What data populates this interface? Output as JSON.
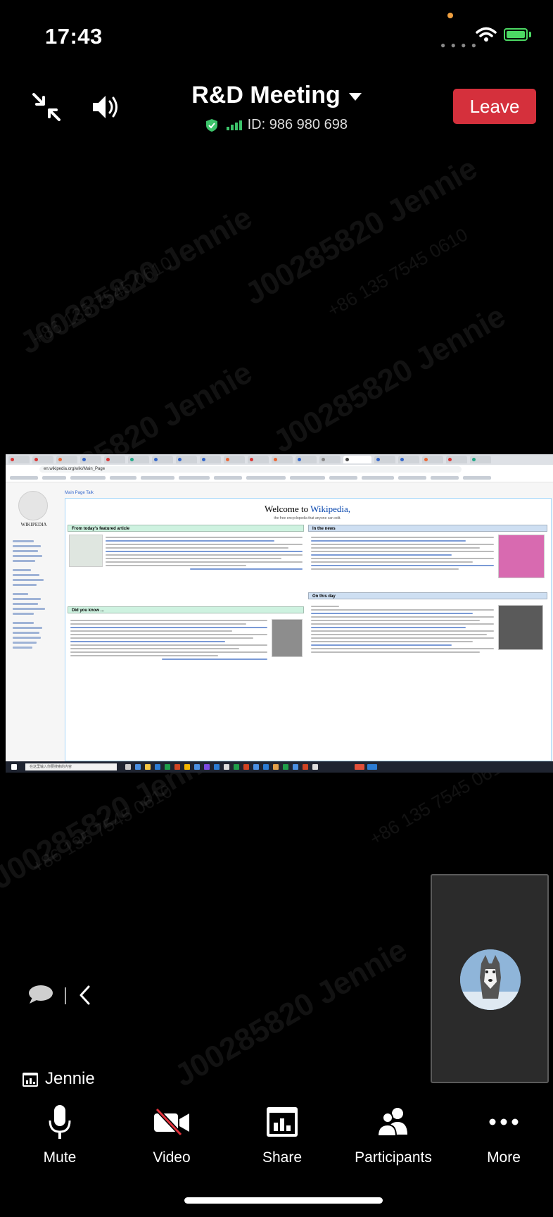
{
  "status_bar": {
    "time": "17:43",
    "battery_color": "#4cd964"
  },
  "header": {
    "meeting_title": "R&D Meeting",
    "meeting_id": "ID: 986 980 698",
    "leave_label": "Leave",
    "leave_color": "#d5303c"
  },
  "watermark": {
    "name_text": "J00285820 Jennie",
    "phone_text": "+86 135 7545 0610"
  },
  "shared_screen": {
    "url": "en.wikipedia.org/wiki/Main_Page",
    "tabs_row": "Main Page   Talk",
    "welcome_title": "Welcome to ",
    "welcome_link": "Wikipedia,",
    "welcome_sub": "the free encyclopedia that anyone can edit.",
    "logo_text": "WIKIPEDIA",
    "featured_heading": "From today's featured article",
    "news_heading": "In the news",
    "dyk_heading": "Did you know ...",
    "otd_heading": "On this day",
    "taskbar_search": "在这里输入你要搜索的内容"
  },
  "participant_tile": {
    "name": "Jennie"
  },
  "toolbar": {
    "items": [
      {
        "label": "Mute",
        "icon": "microphone-icon"
      },
      {
        "label": "Video",
        "icon": "video-off-icon"
      },
      {
        "label": "Share",
        "icon": "share-screen-icon"
      },
      {
        "label": "Participants",
        "icon": "participants-icon"
      },
      {
        "label": "More",
        "icon": "more-icon"
      }
    ]
  }
}
